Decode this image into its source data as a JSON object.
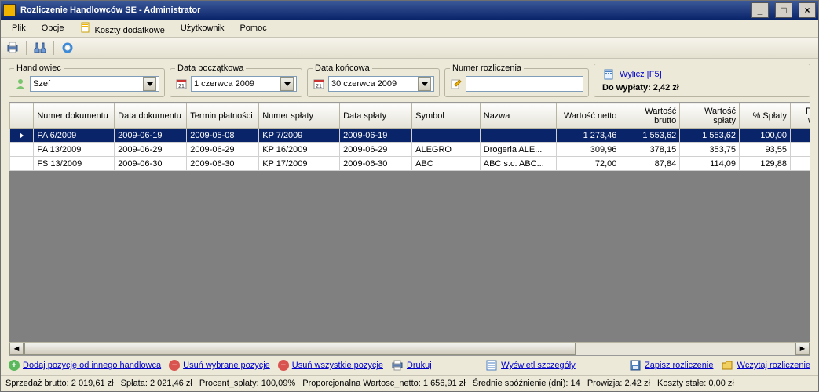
{
  "window": {
    "title": "Rozliczenie Handlowców SE - Administrator"
  },
  "menus": {
    "plik": "Plik",
    "opcje": "Opcje",
    "koszty": "Koszty dodatkowe",
    "uzytkownik": "Użytkownik",
    "pomoc": "Pomoc"
  },
  "filters": {
    "handlowiec": {
      "label": "Handlowiec",
      "value": "Szef"
    },
    "data_pocz": {
      "label": "Data początkowa",
      "value": "1   czerwca   2009"
    },
    "data_kon": {
      "label": "Data końcowa",
      "value": "30   czerwca   2009"
    },
    "numer_rozl": {
      "label": "Numer rozliczenia",
      "value": ""
    }
  },
  "calc": {
    "link": "Wylicz [F5]",
    "summary_label": "Do wypłaty: ",
    "summary_value": "2,42 zł"
  },
  "columns": [
    "Numer dokumentu",
    "Data dokumentu",
    "Termin płatności",
    "Numer spłaty",
    "Data spłaty",
    "Symbol",
    "Nazwa",
    "Wartość netto",
    "Wartość brutto",
    "Wartość spłaty",
    "% Spłaty",
    "Proporcj wartość"
  ],
  "rows": [
    {
      "sel": true,
      "c": [
        "PA 6/2009",
        "2009-06-19",
        "2009-05-08",
        "KP 7/2009",
        "2009-06-19",
        "",
        "",
        "1 273,46",
        "1 553,62",
        "1 553,62",
        "100,00",
        ""
      ]
    },
    {
      "sel": false,
      "c": [
        "PA 13/2009",
        "2009-06-29",
        "2009-06-29",
        "KP 16/2009",
        "2009-06-29",
        "ALEGRO",
        "Drogeria ALE...",
        "309,96",
        "378,15",
        "353,75",
        "93,55",
        ""
      ]
    },
    {
      "sel": false,
      "c": [
        "FS 13/2009",
        "2009-06-30",
        "2009-06-30",
        "KP 17/2009",
        "2009-06-30",
        "ABC",
        "ABC s.c. ABC...",
        "72,00",
        "87,84",
        "114,09",
        "129,88",
        ""
      ]
    }
  ],
  "actions": {
    "add": "Dodaj pozycję od innego handlowca",
    "del_sel": "Usuń wybrane pozycje",
    "del_all": "Usuń wszystkie pozycje",
    "print": "Drukuj",
    "details": "Wyświetl szczegóły",
    "save": "Zapisz rozliczenie",
    "load": "Wczytaj rozliczenie"
  },
  "status": {
    "s1": "Sprzedaż brutto: 2 019,61 zł",
    "s2": "Spłata: 2 021,46 zł",
    "s3": "Procent_splaty: 100,09%",
    "s4": "Proporcjonalna Wartosc_netto: 1 656,91 zł",
    "s5": "Średnie spóźnienie (dni): 14",
    "s6": "Prowizja: 2,42 zł",
    "s7": "Koszty stałe: 0,00 zł"
  }
}
